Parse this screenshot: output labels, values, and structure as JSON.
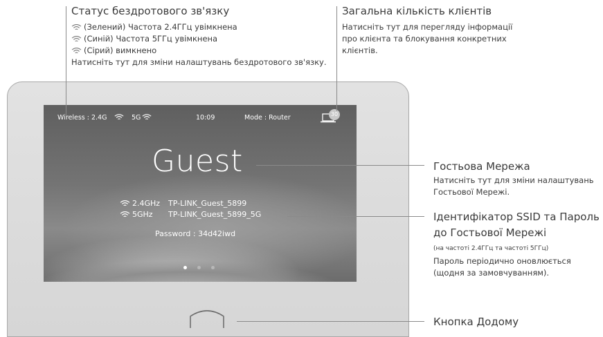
{
  "annotations": {
    "wireless_status": {
      "title": "Статус бездротового зв'язку",
      "items": [
        "(Зелений) Частота 2.4ГГц увімкнена",
        "(Синій) Частота 5ГГц увімкнена",
        "(Сірий) вимкнено"
      ],
      "note": "Натисніть тут для зміни налаштувань бездротового зв'язку."
    },
    "total_clients": {
      "title": "Загальна кількість клієнтів",
      "lines": [
        "Натисніть тут для перегляду інформації",
        "про клієнта та блокування конкретних",
        "клієнтів."
      ]
    },
    "guest_network": {
      "title": "Гостьова Мережа",
      "lines": [
        "Натисніть тут для зміни налаштувань",
        "Гостьової Мережі."
      ]
    },
    "ssid_password": {
      "title_lines": [
        "Ідентифікатор SSID та Пароль",
        "до Гостьової Мережі"
      ],
      "small_note": "(на частоті 2.4ГГц та частоті 5ГГц)",
      "lines": [
        "Пароль періодично оновлюється",
        "(щодня за замовчуванням)."
      ]
    },
    "home_button": {
      "title": "Кнопка Додому"
    }
  },
  "screen": {
    "status_bar": {
      "wireless_label": "Wireless : 2.4G",
      "band_5g": "5G",
      "time": "10:09",
      "mode": "Mode : Router",
      "client_count": "30"
    },
    "title": "Guest",
    "networks": [
      {
        "band": "2.4GHz",
        "ssid": "TP-LINK_Guest_5899"
      },
      {
        "band": "5GHz",
        "ssid": "TP-LINK_Guest_5899_5G"
      }
    ],
    "password": "Password : 34d42iwd",
    "page_dots": {
      "count": 3,
      "active": 1
    }
  },
  "colors": {
    "screen_text": "#ffffff",
    "callout_line": "#8a8a8a",
    "bezel": "#dcdcdc",
    "badge": "#c9c9c9"
  },
  "icons": [
    "wifi-icon",
    "laptop-icon",
    "home-icon"
  ]
}
